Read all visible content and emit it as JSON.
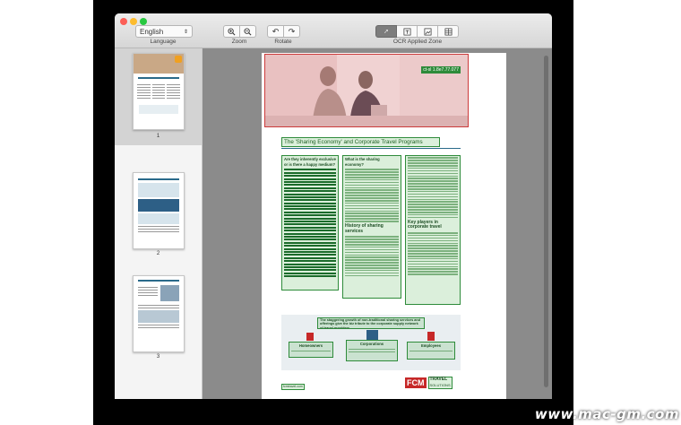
{
  "toolbar": {
    "language_value": "English",
    "language_label": "Language",
    "zoom_label": "Zoom",
    "rotate_label": "Rotate",
    "ocr_label": "OCR Applied Zone"
  },
  "thumbnails": [
    {
      "label": "1"
    },
    {
      "label": "2"
    },
    {
      "label": "3"
    }
  ],
  "document": {
    "title": "The 'Sharing Economy' and Corporate Travel Programs",
    "col1_heading": "Are they inherently exclusive or is there a happy medium?",
    "col2_heading": "What is the sharing economy?",
    "col2_heading2": "History of sharing services",
    "col3_heading": "Key players in corporate travel",
    "banner": "The staggering growth of non-traditional sharing services and offerings give the biz tribute to the corporate supply network of travel providers",
    "box_left": "Homeowners",
    "box_center": "Corporations",
    "box_right": "Employees",
    "logo_fcm": "FCM",
    "logo_travel": "TRAVEL",
    "logo_solutions": "SOLUTIONS",
    "footer_tag": "fcmtravel.com",
    "hero_tag": "ct-sl 1.8e7.77.077"
  },
  "watermark": "www.mac-gm.com",
  "colors": {
    "accent_green": "#2e8b3a",
    "ocr_red": "#cc3b3b",
    "hero_pink": "#f2cccc"
  }
}
